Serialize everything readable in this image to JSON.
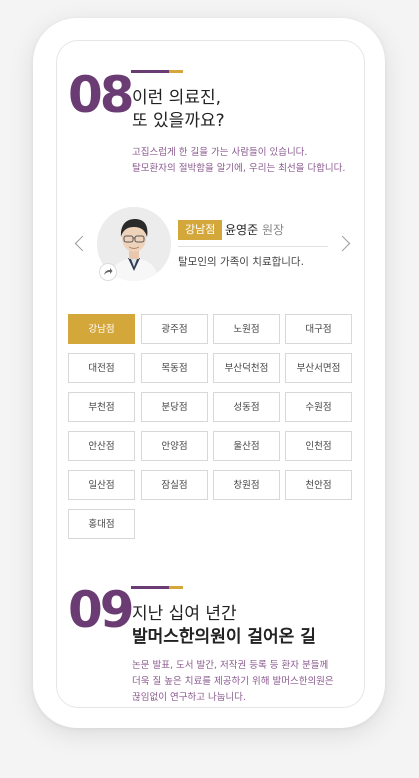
{
  "section1": {
    "number": "08",
    "title_line1": "이런 의료진,",
    "title_line2": "또 있을까요?",
    "desc_line1": "고집스럽게 한 길을 가는 사람들이 있습니다.",
    "desc_line2": "탈모환자의 절박함을 알기에, 우리는 최선을 다합니다."
  },
  "doctor": {
    "branch_badge": "강남점",
    "name": "윤영준",
    "role": "원장",
    "tagline": "탈모인의 가족이 치료합니다."
  },
  "branches": [
    "강남점",
    "광주점",
    "노원점",
    "대구점",
    "대전점",
    "목동점",
    "부산덕천점",
    "부산서면점",
    "부천점",
    "분당점",
    "성동점",
    "수원점",
    "안산점",
    "안양점",
    "울산점",
    "인천점",
    "일산점",
    "잠실점",
    "창원점",
    "천안점",
    "홍대점"
  ],
  "active_branch": "강남점",
  "section2": {
    "number": "09",
    "title_line1": "지난 십여 년간",
    "title_line2": "발머스한의원이 걸어온 길",
    "desc_line1": "논문 발표, 도서 발간, 저작권 등록 등 환자 분들께",
    "desc_line2": "더욱 질 높은 치료를 제공하기 위해 발머스한의원은",
    "desc_line3": "끊임없이 연구하고 나눕니다."
  },
  "colors": {
    "brand_purple": "#6b3b73",
    "accent_gold": "#d4a73a"
  },
  "icons": {
    "prev": "chevron-left-icon",
    "next": "chevron-right-icon",
    "share": "share-icon"
  }
}
